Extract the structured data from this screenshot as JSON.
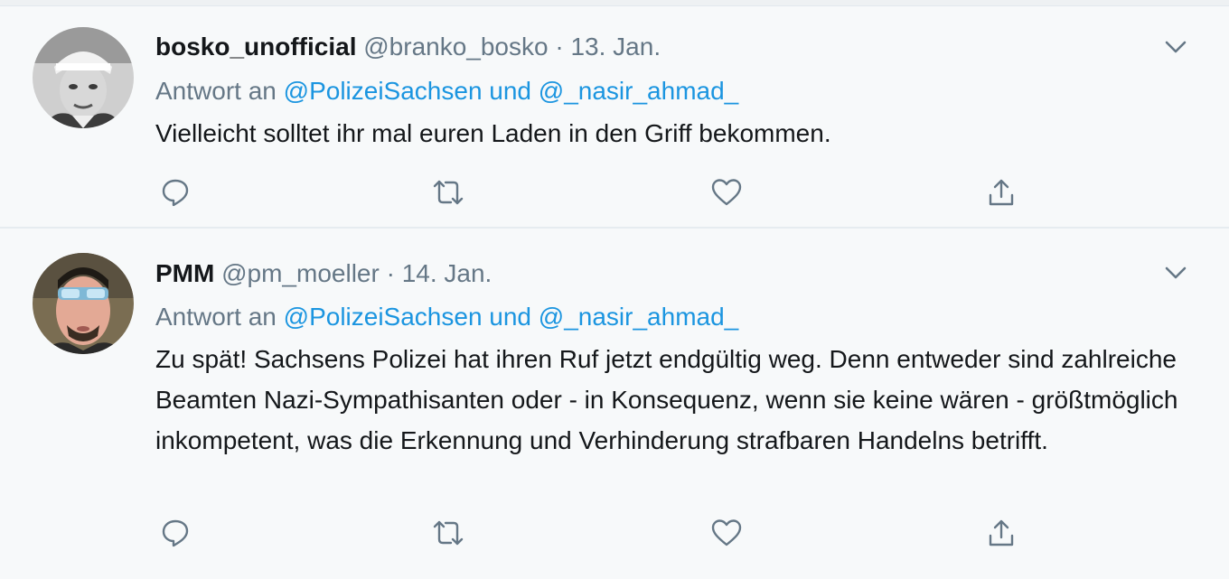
{
  "tweets": [
    {
      "name": "bosko_unofficial",
      "handle": "@branko_bosko",
      "separator": "·",
      "date": "13. Jan.",
      "reply_prefix": "Antwort an",
      "reply_mentions": "@PolizeiSachsen und @_nasir_ahmad_",
      "text": "Vielleicht solltet ihr mal euren Laden in den Griff bekommen."
    },
    {
      "name": "PMM",
      "handle": "@pm_moeller",
      "separator": "·",
      "date": "14. Jan.",
      "reply_prefix": "Antwort an",
      "reply_mentions": "@PolizeiSachsen und @_nasir_ahmad_",
      "text": "Zu spät! Sachsens Polizei hat ihren Ruf jetzt endgültig weg. Denn entweder sind zahlreiche Beamten Nazi-Sympathisanten oder - in Konsequenz, wenn sie keine wären - größtmöglich inkompetent, was die Erkennung  und Verhinderung strafbaren Handelns betrifft."
    }
  ],
  "icons": {
    "caret": "chevron-down-icon",
    "reply": "reply-icon",
    "retweet": "retweet-icon",
    "like": "heart-icon",
    "share": "share-icon"
  },
  "colors": {
    "background": "#f7f9fa",
    "text": "#14171a",
    "secondary": "#657786",
    "link": "#1b95e0"
  }
}
